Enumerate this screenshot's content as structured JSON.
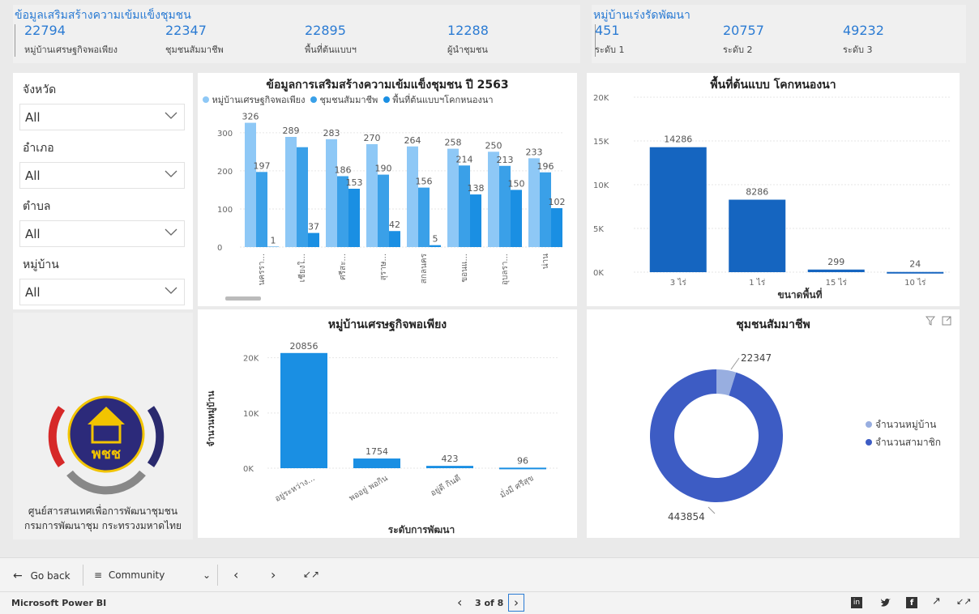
{
  "header_left": {
    "title": "ข้อมูลเสริมสร้างความเข้มแข็งชุมชน",
    "kpis": [
      {
        "value": "22794",
        "label": "หมู่บ้านเศรษฐกิจพอเพียง"
      },
      {
        "value": "22347",
        "label": "ชุมชนสัมมาชีพ"
      },
      {
        "value": "22895",
        "label": "พื้นที่ต้นแบบฯ"
      },
      {
        "value": "12288",
        "label": "ผู้นำชุมชน"
      }
    ]
  },
  "header_right": {
    "title": "หมู่บ้านเร่งรัดพัฒนา",
    "kpis": [
      {
        "value": "451",
        "label": "ระดับ 1"
      },
      {
        "value": "20757",
        "label": "ระดับ 2"
      },
      {
        "value": "49232",
        "label": "ระดับ 3"
      }
    ]
  },
  "slicers": [
    {
      "label": "จังหวัด",
      "value": "All"
    },
    {
      "label": "อำเภอ",
      "value": "All"
    },
    {
      "label": "ตำบล",
      "value": "All"
    },
    {
      "label": "หมู่บ้าน",
      "value": "All"
    }
  ],
  "org": {
    "line1": "ศูนย์สารสนเทศเพื่อการพัฒนาชุมชน",
    "line2": "กรมการพัฒนาชุม กระทรวงมหาดไทย",
    "logo_text": "พชช"
  },
  "colors": {
    "light_blue": "#8ec8f6",
    "mid_blue": "#3aa0e8",
    "dark_blue_bar": "#1a8fe3",
    "navy": "#1565c0",
    "donut_main": "#3d5cc4",
    "donut_light": "#98aee0"
  },
  "chart_data": [
    {
      "type": "bar",
      "title": "ข้อมูลการเสริมสร้างความเข้มแข็งชุมชน ปี 2563",
      "legend": [
        "หมู่บ้านเศรษฐกิจพอเพียง",
        "ชุมชนสัมมาชีพ",
        "พื้นที่ต้นแบบฯโคกหนองนา"
      ],
      "categories": [
        "นครรา...",
        "เชียงใ...",
        "ศรีสะ...",
        "สุราษ...",
        "สกลนคร",
        "ขอนแ...",
        "อุบลรา...",
        "น่าน"
      ],
      "series": [
        {
          "name": "หมู่บ้านเศรษฐกิจพอเพียง",
          "values": [
            326,
            289,
            283,
            270,
            264,
            258,
            250,
            233
          ]
        },
        {
          "name": "ชุมชนสัมมาชีพ",
          "values": [
            197,
            262,
            186,
            190,
            156,
            214,
            213,
            196
          ]
        },
        {
          "name": "พื้นที่ต้นแบบฯโคกหนองนา",
          "values": [
            1,
            37,
            153,
            42,
            5,
            138,
            150,
            102
          ]
        }
      ],
      "visible_labels": [
        [
          "326",
          "289",
          "283",
          "270",
          "264",
          "258",
          "250",
          "233"
        ],
        [
          "197",
          "",
          "186",
          "190",
          "156",
          "214",
          "213",
          "196"
        ],
        [
          "1",
          "37",
          "153",
          "42",
          "5",
          "138",
          "150",
          "102"
        ]
      ],
      "yticks": [
        "0",
        "100",
        "200",
        "300"
      ],
      "ylim": [
        0,
        340
      ]
    },
    {
      "type": "bar",
      "title": "พื้นที่ต้นแบบ โคกหนองนา",
      "categories": [
        "3 ไร่",
        "1 ไร่",
        "15 ไร่",
        "10 ไร่"
      ],
      "values": [
        14286,
        8286,
        299,
        24
      ],
      "xlabel": "ขนาดพื้นที่",
      "yticks": [
        "0K",
        "5K",
        "10K",
        "15K",
        "20K"
      ],
      "ylim": [
        0,
        20000
      ]
    },
    {
      "type": "bar",
      "title": "หมู่บ้านเศรษฐกิจพอเพียง",
      "categories": [
        "อยู่ระหว่าง...",
        "พออยู่ พอกิน",
        "อยู่ดี กินดี",
        "มั่งมี ศรีสุข"
      ],
      "values": [
        20856,
        1754,
        423,
        96
      ],
      "xlabel": "ระดับการพัฒนา",
      "ylabel": "จำนวนหมู่บ้าน",
      "yticks": [
        "0K",
        "10K",
        "20K"
      ],
      "ylim": [
        0,
        22000
      ]
    },
    {
      "type": "pie",
      "title": "ชุมชนสัมมาชีพ",
      "slices": [
        {
          "name": "จำนวนหมู่บ้าน",
          "value": 22347
        },
        {
          "name": "จำนวนสามาชิก",
          "value": 443854
        }
      ],
      "labels": [
        "22347",
        "443854"
      ]
    }
  ],
  "nav": {
    "back": "Go back",
    "page": "Community",
    "brand": "Microsoft Power BI",
    "pager": "3 of 8"
  }
}
